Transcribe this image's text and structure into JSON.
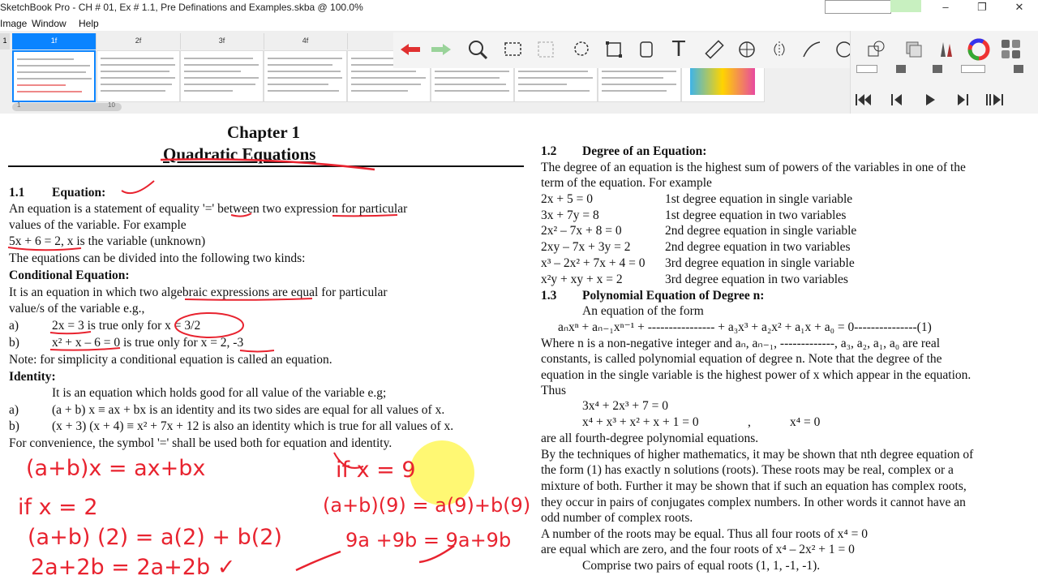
{
  "window": {
    "title": "SketchBook Pro - CH # 01, Ex # 1.1, Pre Definations and Examples.skba @ 100.0%",
    "controls": [
      "–",
      "❐",
      "✕"
    ]
  },
  "menu": [
    "Image",
    "Window",
    "Help"
  ],
  "tabs": [
    "1f",
    "2f",
    "3f",
    "4f"
  ],
  "tab_marker": "1",
  "slider_labels": [
    "1",
    "10"
  ],
  "doc": {
    "left": {
      "chapter": "Chapter 1",
      "chapter_title": "Quadratic Equations",
      "s11_num": "1.1",
      "s11_title": "Equation:",
      "p1": "An equation is a statement of equality '=' between two expression for particular",
      "p2": "values of the variable. For example",
      "p3": "5x + 6 = 2, x is the variable (unknown)",
      "p4": "The equations can be divided into the following two kinds:",
      "cond_title": "Conditional Equation:",
      "c1": "It is an equation in which two algebraic expressions are equal for particular",
      "c2": "value/s of the variable e.g.,",
      "ca_label": "a)",
      "ca_text": "2x = 3 is true only for x = 3/2",
      "cb_label": "b)",
      "cb_text": "x² + x – 6 = 0 is true only for x = 2, -3",
      "note": "Note: for simplicity a conditional equation is called an equation.",
      "identity_title": "Identity:",
      "i1": "It is an equation which holds good for all value of the variable e.g;",
      "ia_label": "a)",
      "ia_text": "(a + b) x ≡ ax + bx is an identity and its two sides are equal for all values of x.",
      "ib_label": "b)",
      "ib_text": "(x + 3) (x + 4) ≡ x² + 7x + 12 is also an identity which is true for all values of x.",
      "conv": "For convenience, the symbol '=' shall be used both for equation and identity."
    },
    "right": {
      "s12_num": "1.2",
      "s12_title": "Degree of an Equation:",
      "d1": "The degree of an equation is the highest sum of powers of the variables in one of the",
      "d2": "term of the equation. For example",
      "examples": [
        {
          "eq": "2x + 5 = 0",
          "desc": "1st degree equation in single variable"
        },
        {
          "eq": "3x + 7y = 8",
          "desc": "1st degree equation in two variables"
        },
        {
          "eq": "2x² – 7x + 8 = 0",
          "desc": "2nd degree equation in single variable"
        },
        {
          "eq": "2xy – 7x + 3y = 2",
          "desc": "2nd degree equation in two variables"
        },
        {
          "eq": "x³ – 2x² + 7x + 4 = 0",
          "desc": "3rd degree equation in single variable"
        },
        {
          "eq": "x²y + xy + x = 2",
          "desc": "3rd degree equation in two variables"
        }
      ],
      "s13_num": "1.3",
      "s13_title": "Polynomial  Equation of Degree n:",
      "p_form": "An equation of the form",
      "p_eq": "aₙxⁿ + aₙ₋₁xⁿ⁻¹ + ---------------- + a₃x³ + a₂x² + a₁x + a₀ = 0---------------(1)",
      "w1": "Where n is a non-negative integer and aₙ, aₙ₋₁, -------------, a₃, a₂, a₁, a₀ are real",
      "w2": "constants, is called polynomial equation of degree n. Note that the degree of the",
      "w3": "equation in the single variable is the highest power of x which appear in the equation.",
      "thus": "Thus",
      "q1": "3x⁴ + 2x³ + 7 = 0",
      "q2": "x⁴ + x³ + x² + x + 1 = 0",
      "q2b": ",",
      "q3": "x⁴ = 0",
      "fourth": "are all fourth-degree  polynomial  equations.",
      "t1": "By the techniques of higher mathematics, it may be shown that nth degree equation of",
      "t2": "the form (1) has exactly n solutions (roots). These roots may be real, complex or a",
      "t3": "mixture of both. Further it may be shown that if such an equation has complex roots,",
      "t4": "they occur in pairs of conjugates complex numbers. In other words it cannot have an",
      "t5": "odd number of complex roots.",
      "n1": "A number of the roots may be equal. Thus all four roots of   x⁴ = 0",
      "n2": "are equal which are zero, and the four roots of    x⁴ – 2x² + 1 = 0",
      "n3": "Comprise two pairs of equal roots (1, 1, -1, -1)."
    },
    "handwriting": {
      "h1": "(a+b)x = ax+bx",
      "h2": "if  x = 2",
      "h3": "(a+b) (2) = a(2) + b(2)",
      "h4": "2a+2b = 2a+2b ✓",
      "h5": "if  x = 9",
      "h6": "(a+b)(9) = a(9)+b(9)",
      "h7": "9a +9b = 9a+9b"
    }
  },
  "colors": {
    "ink": "#e8232f",
    "tab_active": "#0a84ff",
    "highlight": "#fff200"
  }
}
